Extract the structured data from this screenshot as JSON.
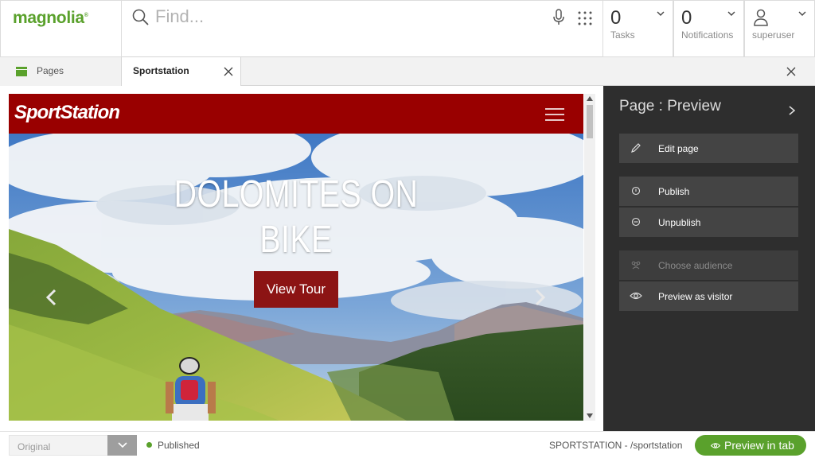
{
  "header": {
    "logo": "magnolia",
    "search": {
      "placeholder": "Find..."
    },
    "tasks": {
      "count": "0",
      "label": "Tasks"
    },
    "notifications": {
      "count": "0",
      "label": "Notifications"
    },
    "user": {
      "label": "superuser"
    }
  },
  "tabs": {
    "pages_label": "Pages",
    "active_label": "Sportstation"
  },
  "site": {
    "logo": "SportStation",
    "hero_title": "DOLOMITES ON BIKE",
    "hero_button": "View Tour"
  },
  "panel": {
    "title": "Page : Preview",
    "actions": [
      {
        "label": "Edit page",
        "icon": "pencil-icon",
        "enabled": true
      },
      {
        "label": "Publish",
        "icon": "publish-icon",
        "enabled": true
      },
      {
        "label": "Unpublish",
        "icon": "unpublish-icon",
        "enabled": true
      },
      {
        "label": "Choose audience",
        "icon": "audience-icon",
        "enabled": false
      },
      {
        "label": "Preview as visitor",
        "icon": "eye-icon",
        "enabled": true
      }
    ]
  },
  "footer": {
    "variant": "Original",
    "status": "Published",
    "path": "SPORTSTATION - /sportstation",
    "preview_button": "Preview in tab"
  },
  "colors": {
    "brand_green": "#5aa12c",
    "site_red": "#990000",
    "panel_bg": "#2e2e2e",
    "action_bg": "#444444"
  }
}
